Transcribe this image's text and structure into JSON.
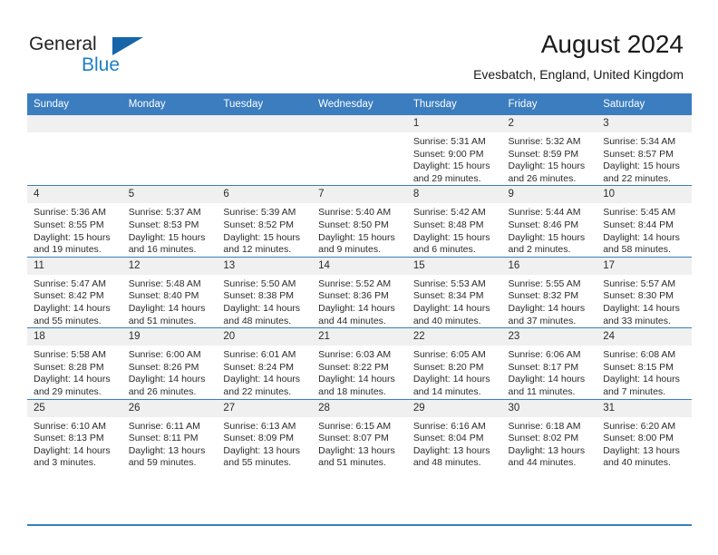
{
  "brand": {
    "line1": "General",
    "line2": "Blue",
    "triangle_color": "#1565a8",
    "line2_color": "#1f7ec4"
  },
  "header": {
    "month_title": "August 2024",
    "location": "Evesbatch, England, United Kingdom"
  },
  "theme": {
    "header_blue": "#3b7dbf",
    "band_gray": "#f0f0f0",
    "text": "#2b2b2b"
  },
  "weekday_headers": [
    "Sunday",
    "Monday",
    "Tuesday",
    "Wednesday",
    "Thursday",
    "Friday",
    "Saturday"
  ],
  "labels": {
    "sunrise_prefix": "Sunrise:",
    "sunset_prefix": "Sunset:",
    "daylight_prefix": "Daylight:"
  },
  "weeks": [
    [
      {
        "day": "",
        "sunrise": "",
        "sunset": "",
        "daylight_a": "",
        "daylight_b": ""
      },
      {
        "day": "",
        "sunrise": "",
        "sunset": "",
        "daylight_a": "",
        "daylight_b": ""
      },
      {
        "day": "",
        "sunrise": "",
        "sunset": "",
        "daylight_a": "",
        "daylight_b": ""
      },
      {
        "day": "",
        "sunrise": "",
        "sunset": "",
        "daylight_a": "",
        "daylight_b": ""
      },
      {
        "day": "1",
        "sunrise": "Sunrise: 5:31 AM",
        "sunset": "Sunset: 9:00 PM",
        "daylight_a": "Daylight: 15 hours",
        "daylight_b": "and 29 minutes."
      },
      {
        "day": "2",
        "sunrise": "Sunrise: 5:32 AM",
        "sunset": "Sunset: 8:59 PM",
        "daylight_a": "Daylight: 15 hours",
        "daylight_b": "and 26 minutes."
      },
      {
        "day": "3",
        "sunrise": "Sunrise: 5:34 AM",
        "sunset": "Sunset: 8:57 PM",
        "daylight_a": "Daylight: 15 hours",
        "daylight_b": "and 22 minutes."
      }
    ],
    [
      {
        "day": "4",
        "sunrise": "Sunrise: 5:36 AM",
        "sunset": "Sunset: 8:55 PM",
        "daylight_a": "Daylight: 15 hours",
        "daylight_b": "and 19 minutes."
      },
      {
        "day": "5",
        "sunrise": "Sunrise: 5:37 AM",
        "sunset": "Sunset: 8:53 PM",
        "daylight_a": "Daylight: 15 hours",
        "daylight_b": "and 16 minutes."
      },
      {
        "day": "6",
        "sunrise": "Sunrise: 5:39 AM",
        "sunset": "Sunset: 8:52 PM",
        "daylight_a": "Daylight: 15 hours",
        "daylight_b": "and 12 minutes."
      },
      {
        "day": "7",
        "sunrise": "Sunrise: 5:40 AM",
        "sunset": "Sunset: 8:50 PM",
        "daylight_a": "Daylight: 15 hours",
        "daylight_b": "and 9 minutes."
      },
      {
        "day": "8",
        "sunrise": "Sunrise: 5:42 AM",
        "sunset": "Sunset: 8:48 PM",
        "daylight_a": "Daylight: 15 hours",
        "daylight_b": "and 6 minutes."
      },
      {
        "day": "9",
        "sunrise": "Sunrise: 5:44 AM",
        "sunset": "Sunset: 8:46 PM",
        "daylight_a": "Daylight: 15 hours",
        "daylight_b": "and 2 minutes."
      },
      {
        "day": "10",
        "sunrise": "Sunrise: 5:45 AM",
        "sunset": "Sunset: 8:44 PM",
        "daylight_a": "Daylight: 14 hours",
        "daylight_b": "and 58 minutes."
      }
    ],
    [
      {
        "day": "11",
        "sunrise": "Sunrise: 5:47 AM",
        "sunset": "Sunset: 8:42 PM",
        "daylight_a": "Daylight: 14 hours",
        "daylight_b": "and 55 minutes."
      },
      {
        "day": "12",
        "sunrise": "Sunrise: 5:48 AM",
        "sunset": "Sunset: 8:40 PM",
        "daylight_a": "Daylight: 14 hours",
        "daylight_b": "and 51 minutes."
      },
      {
        "day": "13",
        "sunrise": "Sunrise: 5:50 AM",
        "sunset": "Sunset: 8:38 PM",
        "daylight_a": "Daylight: 14 hours",
        "daylight_b": "and 48 minutes."
      },
      {
        "day": "14",
        "sunrise": "Sunrise: 5:52 AM",
        "sunset": "Sunset: 8:36 PM",
        "daylight_a": "Daylight: 14 hours",
        "daylight_b": "and 44 minutes."
      },
      {
        "day": "15",
        "sunrise": "Sunrise: 5:53 AM",
        "sunset": "Sunset: 8:34 PM",
        "daylight_a": "Daylight: 14 hours",
        "daylight_b": "and 40 minutes."
      },
      {
        "day": "16",
        "sunrise": "Sunrise: 5:55 AM",
        "sunset": "Sunset: 8:32 PM",
        "daylight_a": "Daylight: 14 hours",
        "daylight_b": "and 37 minutes."
      },
      {
        "day": "17",
        "sunrise": "Sunrise: 5:57 AM",
        "sunset": "Sunset: 8:30 PM",
        "daylight_a": "Daylight: 14 hours",
        "daylight_b": "and 33 minutes."
      }
    ],
    [
      {
        "day": "18",
        "sunrise": "Sunrise: 5:58 AM",
        "sunset": "Sunset: 8:28 PM",
        "daylight_a": "Daylight: 14 hours",
        "daylight_b": "and 29 minutes."
      },
      {
        "day": "19",
        "sunrise": "Sunrise: 6:00 AM",
        "sunset": "Sunset: 8:26 PM",
        "daylight_a": "Daylight: 14 hours",
        "daylight_b": "and 26 minutes."
      },
      {
        "day": "20",
        "sunrise": "Sunrise: 6:01 AM",
        "sunset": "Sunset: 8:24 PM",
        "daylight_a": "Daylight: 14 hours",
        "daylight_b": "and 22 minutes."
      },
      {
        "day": "21",
        "sunrise": "Sunrise: 6:03 AM",
        "sunset": "Sunset: 8:22 PM",
        "daylight_a": "Daylight: 14 hours",
        "daylight_b": "and 18 minutes."
      },
      {
        "day": "22",
        "sunrise": "Sunrise: 6:05 AM",
        "sunset": "Sunset: 8:20 PM",
        "daylight_a": "Daylight: 14 hours",
        "daylight_b": "and 14 minutes."
      },
      {
        "day": "23",
        "sunrise": "Sunrise: 6:06 AM",
        "sunset": "Sunset: 8:17 PM",
        "daylight_a": "Daylight: 14 hours",
        "daylight_b": "and 11 minutes."
      },
      {
        "day": "24",
        "sunrise": "Sunrise: 6:08 AM",
        "sunset": "Sunset: 8:15 PM",
        "daylight_a": "Daylight: 14 hours",
        "daylight_b": "and 7 minutes."
      }
    ],
    [
      {
        "day": "25",
        "sunrise": "Sunrise: 6:10 AM",
        "sunset": "Sunset: 8:13 PM",
        "daylight_a": "Daylight: 14 hours",
        "daylight_b": "and 3 minutes."
      },
      {
        "day": "26",
        "sunrise": "Sunrise: 6:11 AM",
        "sunset": "Sunset: 8:11 PM",
        "daylight_a": "Daylight: 13 hours",
        "daylight_b": "and 59 minutes."
      },
      {
        "day": "27",
        "sunrise": "Sunrise: 6:13 AM",
        "sunset": "Sunset: 8:09 PM",
        "daylight_a": "Daylight: 13 hours",
        "daylight_b": "and 55 minutes."
      },
      {
        "day": "28",
        "sunrise": "Sunrise: 6:15 AM",
        "sunset": "Sunset: 8:07 PM",
        "daylight_a": "Daylight: 13 hours",
        "daylight_b": "and 51 minutes."
      },
      {
        "day": "29",
        "sunrise": "Sunrise: 6:16 AM",
        "sunset": "Sunset: 8:04 PM",
        "daylight_a": "Daylight: 13 hours",
        "daylight_b": "and 48 minutes."
      },
      {
        "day": "30",
        "sunrise": "Sunrise: 6:18 AM",
        "sunset": "Sunset: 8:02 PM",
        "daylight_a": "Daylight: 13 hours",
        "daylight_b": "and 44 minutes."
      },
      {
        "day": "31",
        "sunrise": "Sunrise: 6:20 AM",
        "sunset": "Sunset: 8:00 PM",
        "daylight_a": "Daylight: 13 hours",
        "daylight_b": "and 40 minutes."
      }
    ]
  ]
}
